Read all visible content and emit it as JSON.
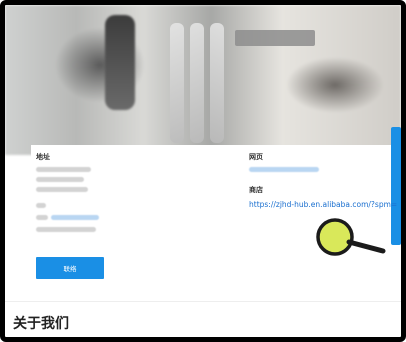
{
  "card": {
    "address_label": "地址",
    "homepage_label": "网页",
    "store_label": "商店",
    "store_url": "https://zjhd-hub.en.alibaba.com/?spm=",
    "button_label": "联络"
  },
  "section": {
    "about_title": "关于我们"
  },
  "colors": {
    "accent_blue": "#1a8fe5",
    "link_blue": "#1a6fcf",
    "magnifier_lens": "#d9e85a"
  },
  "icons": {
    "magnifier": "magnifying-glass"
  }
}
